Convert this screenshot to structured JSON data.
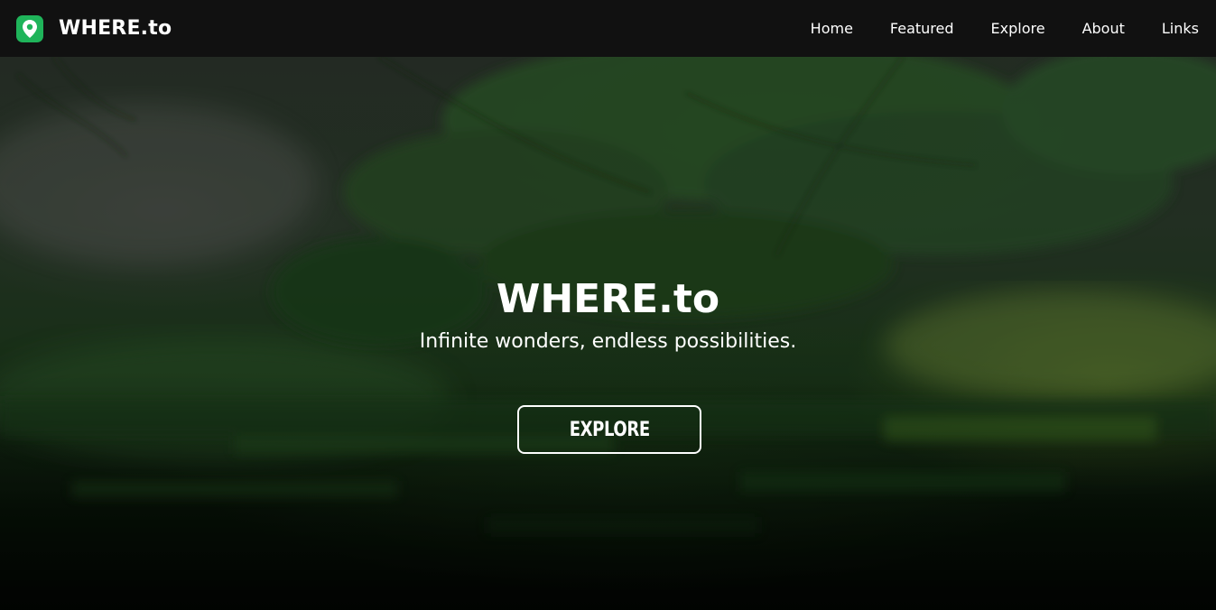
{
  "navbar": {
    "brand": {
      "icon": "map-pin-icon",
      "icon_color": "#1fb45a",
      "name": "WHERE.to"
    },
    "links": [
      {
        "label": "Home"
      },
      {
        "label": "Featured"
      },
      {
        "label": "Explore"
      },
      {
        "label": "About"
      },
      {
        "label": "Links"
      }
    ],
    "background": "#111111"
  },
  "hero": {
    "title": "WHERE.to",
    "subtitle": "Infinite wonders, endless possibilities.",
    "button_label": "EXPLORE",
    "background_image": "forest-lake-photo"
  }
}
